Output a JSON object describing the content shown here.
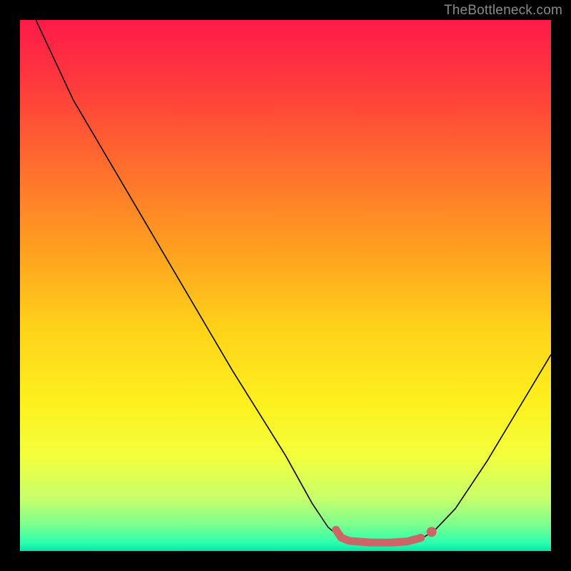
{
  "watermark": "TheBottleneck.com",
  "chart_data": {
    "type": "line",
    "title": "",
    "xlabel": "",
    "ylabel": "",
    "xlim": [
      0,
      100
    ],
    "ylim": [
      0,
      100
    ],
    "grid": false,
    "legend": false,
    "background_gradient": {
      "stops": [
        {
          "pos": 0.0,
          "color": "#ff1a49"
        },
        {
          "pos": 0.12,
          "color": "#ff3a3d"
        },
        {
          "pos": 0.28,
          "color": "#ff6f2d"
        },
        {
          "pos": 0.44,
          "color": "#ffa21f"
        },
        {
          "pos": 0.58,
          "color": "#ffd21a"
        },
        {
          "pos": 0.72,
          "color": "#fdf01e"
        },
        {
          "pos": 0.82,
          "color": "#f4ff3c"
        },
        {
          "pos": 0.9,
          "color": "#c8ff6a"
        },
        {
          "pos": 0.95,
          "color": "#7dff8e"
        },
        {
          "pos": 0.985,
          "color": "#2cffb0"
        },
        {
          "pos": 1.0,
          "color": "#00e6a5"
        }
      ]
    },
    "series": [
      {
        "name": "bottleneck-curve",
        "color": "#000000",
        "width": 1.6,
        "points": [
          {
            "x": 3.0,
            "y": 100.0
          },
          {
            "x": 10.0,
            "y": 85.0
          },
          {
            "x": 20.0,
            "y": 68.0
          },
          {
            "x": 30.0,
            "y": 51.0
          },
          {
            "x": 40.0,
            "y": 34.0
          },
          {
            "x": 50.0,
            "y": 18.0
          },
          {
            "x": 55.0,
            "y": 9.0
          },
          {
            "x": 58.0,
            "y": 4.5
          },
          {
            "x": 60.0,
            "y": 2.8
          },
          {
            "x": 62.0,
            "y": 2.0
          },
          {
            "x": 66.0,
            "y": 1.6
          },
          {
            "x": 70.0,
            "y": 1.6
          },
          {
            "x": 73.0,
            "y": 1.8
          },
          {
            "x": 76.0,
            "y": 2.6
          },
          {
            "x": 78.0,
            "y": 3.8
          },
          {
            "x": 82.0,
            "y": 8.0
          },
          {
            "x": 88.0,
            "y": 17.0
          },
          {
            "x": 94.0,
            "y": 27.0
          },
          {
            "x": 100.0,
            "y": 37.0
          }
        ]
      },
      {
        "name": "optimal-range-marker",
        "color": "#cc6666",
        "width": 11,
        "linecap": "round",
        "points": [
          {
            "x": 59.5,
            "y": 4.0
          },
          {
            "x": 60.5,
            "y": 2.5
          },
          {
            "x": 62.0,
            "y": 1.9
          },
          {
            "x": 66.0,
            "y": 1.6
          },
          {
            "x": 70.0,
            "y": 1.6
          },
          {
            "x": 73.0,
            "y": 1.8
          },
          {
            "x": 75.5,
            "y": 2.5
          }
        ]
      },
      {
        "name": "optimal-range-endpoint",
        "color": "#cc6666",
        "type_hint": "dot",
        "radius": 7,
        "points": [
          {
            "x": 77.5,
            "y": 3.6
          }
        ]
      }
    ]
  }
}
